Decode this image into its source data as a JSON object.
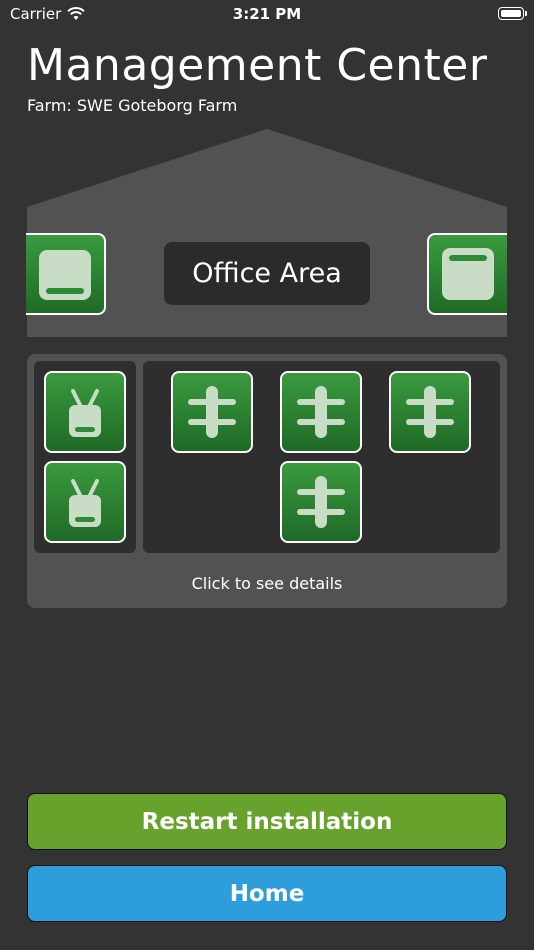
{
  "status_bar": {
    "carrier": "Carrier",
    "time": "3:21 PM",
    "icons": [
      "wifi-icon",
      "battery-icon"
    ]
  },
  "header": {
    "title": "Management Center",
    "subtitle": "Farm: SWE Goteborg Farm"
  },
  "house": {
    "area_label": "Office Area",
    "left_device_icon": "panel-bottom-icon",
    "right_device_icon": "panel-top-icon"
  },
  "devices": {
    "group_a_icon": "antenna-device-icon",
    "group_b_icon": "fence-connector-icon",
    "details_hint": "Click to see details"
  },
  "buttons": {
    "restart_label": "Restart installation",
    "home_label": "Home"
  },
  "colors": {
    "background": "#333333",
    "tile_green": "#2e8a35",
    "restart_green": "#67a32c",
    "home_blue": "#2e9ddc"
  }
}
